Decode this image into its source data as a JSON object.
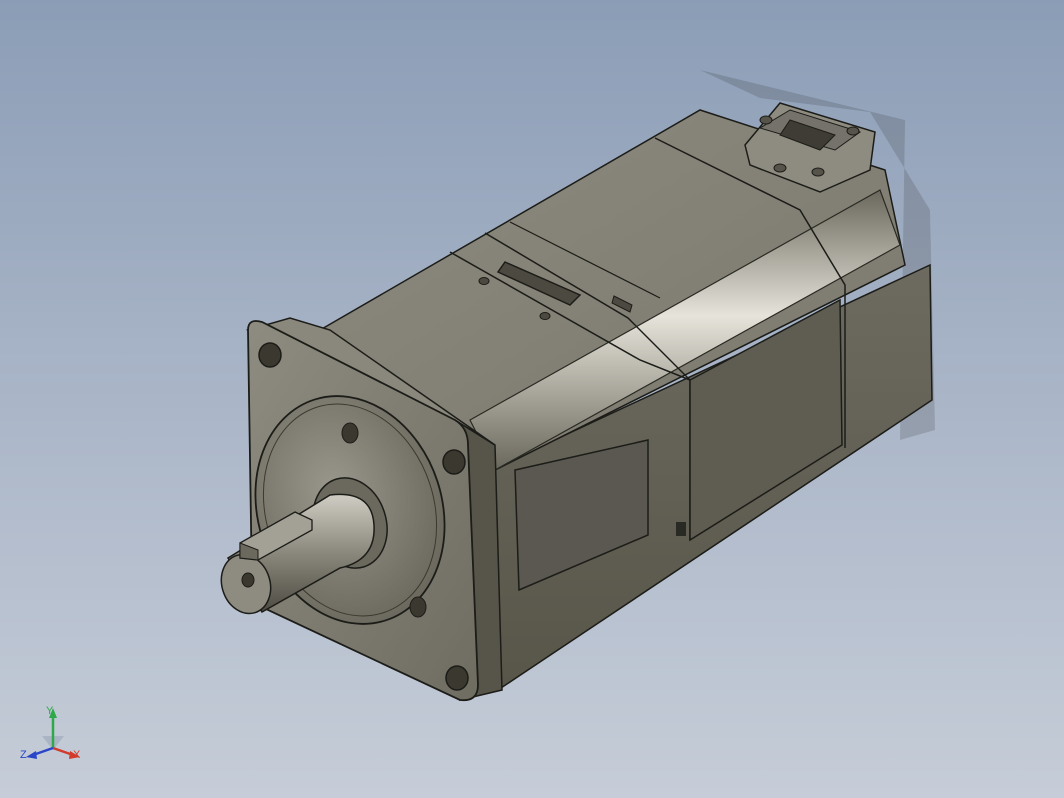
{
  "viewport": {
    "background_top": "#8b9db6",
    "background_bottom": "#c6cdd8",
    "model_color": "#7d7b6e"
  },
  "model": {
    "part": "servo-motor"
  },
  "triad": {
    "x_label": "X",
    "y_label": "Y",
    "z_label": "Z",
    "x_color": "#d23a2a",
    "y_color": "#2fa84a",
    "z_color": "#2a46c8"
  }
}
